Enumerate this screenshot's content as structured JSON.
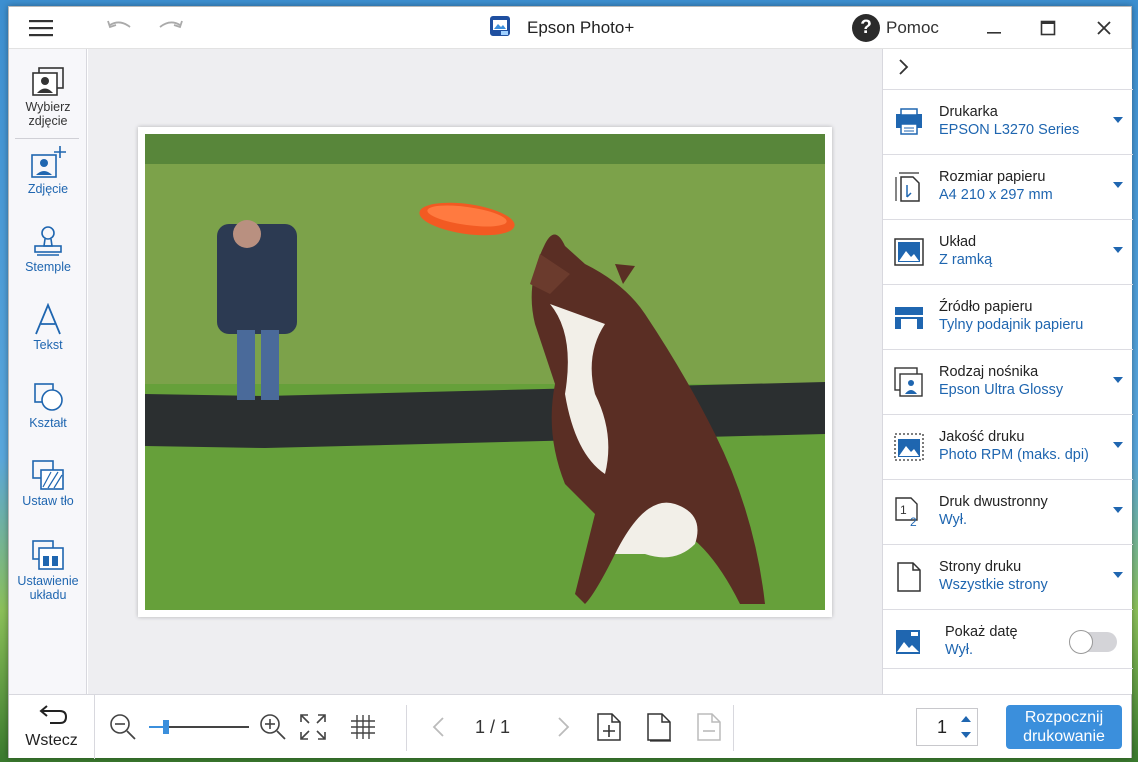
{
  "window": {
    "title": "Epson Photo+"
  },
  "help": {
    "label": "Pomoc"
  },
  "sidebar": {
    "items": [
      {
        "label": "Wybierz zdjęcie",
        "icon": "select-photo-icon"
      },
      {
        "label": "Zdjęcie",
        "icon": "add-photo-icon"
      },
      {
        "label": "Stemple",
        "icon": "stamp-icon"
      },
      {
        "label": "Tekst",
        "icon": "text-icon"
      },
      {
        "label": "Kształt",
        "icon": "shape-icon"
      },
      {
        "label": "Ustaw tło",
        "icon": "background-icon"
      },
      {
        "label": "Ustawienie układu",
        "icon": "layout-icon"
      }
    ]
  },
  "settings": [
    {
      "label": "Drukarka",
      "value": "EPSON L3270 Series",
      "icon": "printer-icon"
    },
    {
      "label": "Rozmiar papieru",
      "value": "A4 210 x 297 mm",
      "icon": "paper-size-icon"
    },
    {
      "label": "Układ",
      "value": "Z ramką",
      "icon": "layout-border-icon"
    },
    {
      "label": "Źródło papieru",
      "value": "Tylny podajnik papieru",
      "icon": "paper-source-icon"
    },
    {
      "label": "Rodzaj nośnika",
      "value": "Epson Ultra Glossy",
      "icon": "media-type-icon"
    },
    {
      "label": "Jakość druku",
      "value": "Photo RPM (maks. dpi)",
      "icon": "print-quality-icon"
    },
    {
      "label": "Druk dwustronny",
      "value": "Wył.",
      "icon": "duplex-icon"
    },
    {
      "label": "Strony druku",
      "value": "Wszystkie strony",
      "icon": "pages-icon"
    },
    {
      "label": "Pokaż datę",
      "value": "Wył.",
      "icon": "show-date-icon",
      "toggle": false
    }
  ],
  "bottom": {
    "back_label": "Wstecz",
    "page_indicator": "1 / 1",
    "copies": "1",
    "print_label_line1": "Rozpocznij",
    "print_label_line2": "drukowanie",
    "zoom_level": 0.2
  },
  "colors": {
    "accent": "#1f66b0",
    "print_button": "#3b8fdc"
  }
}
